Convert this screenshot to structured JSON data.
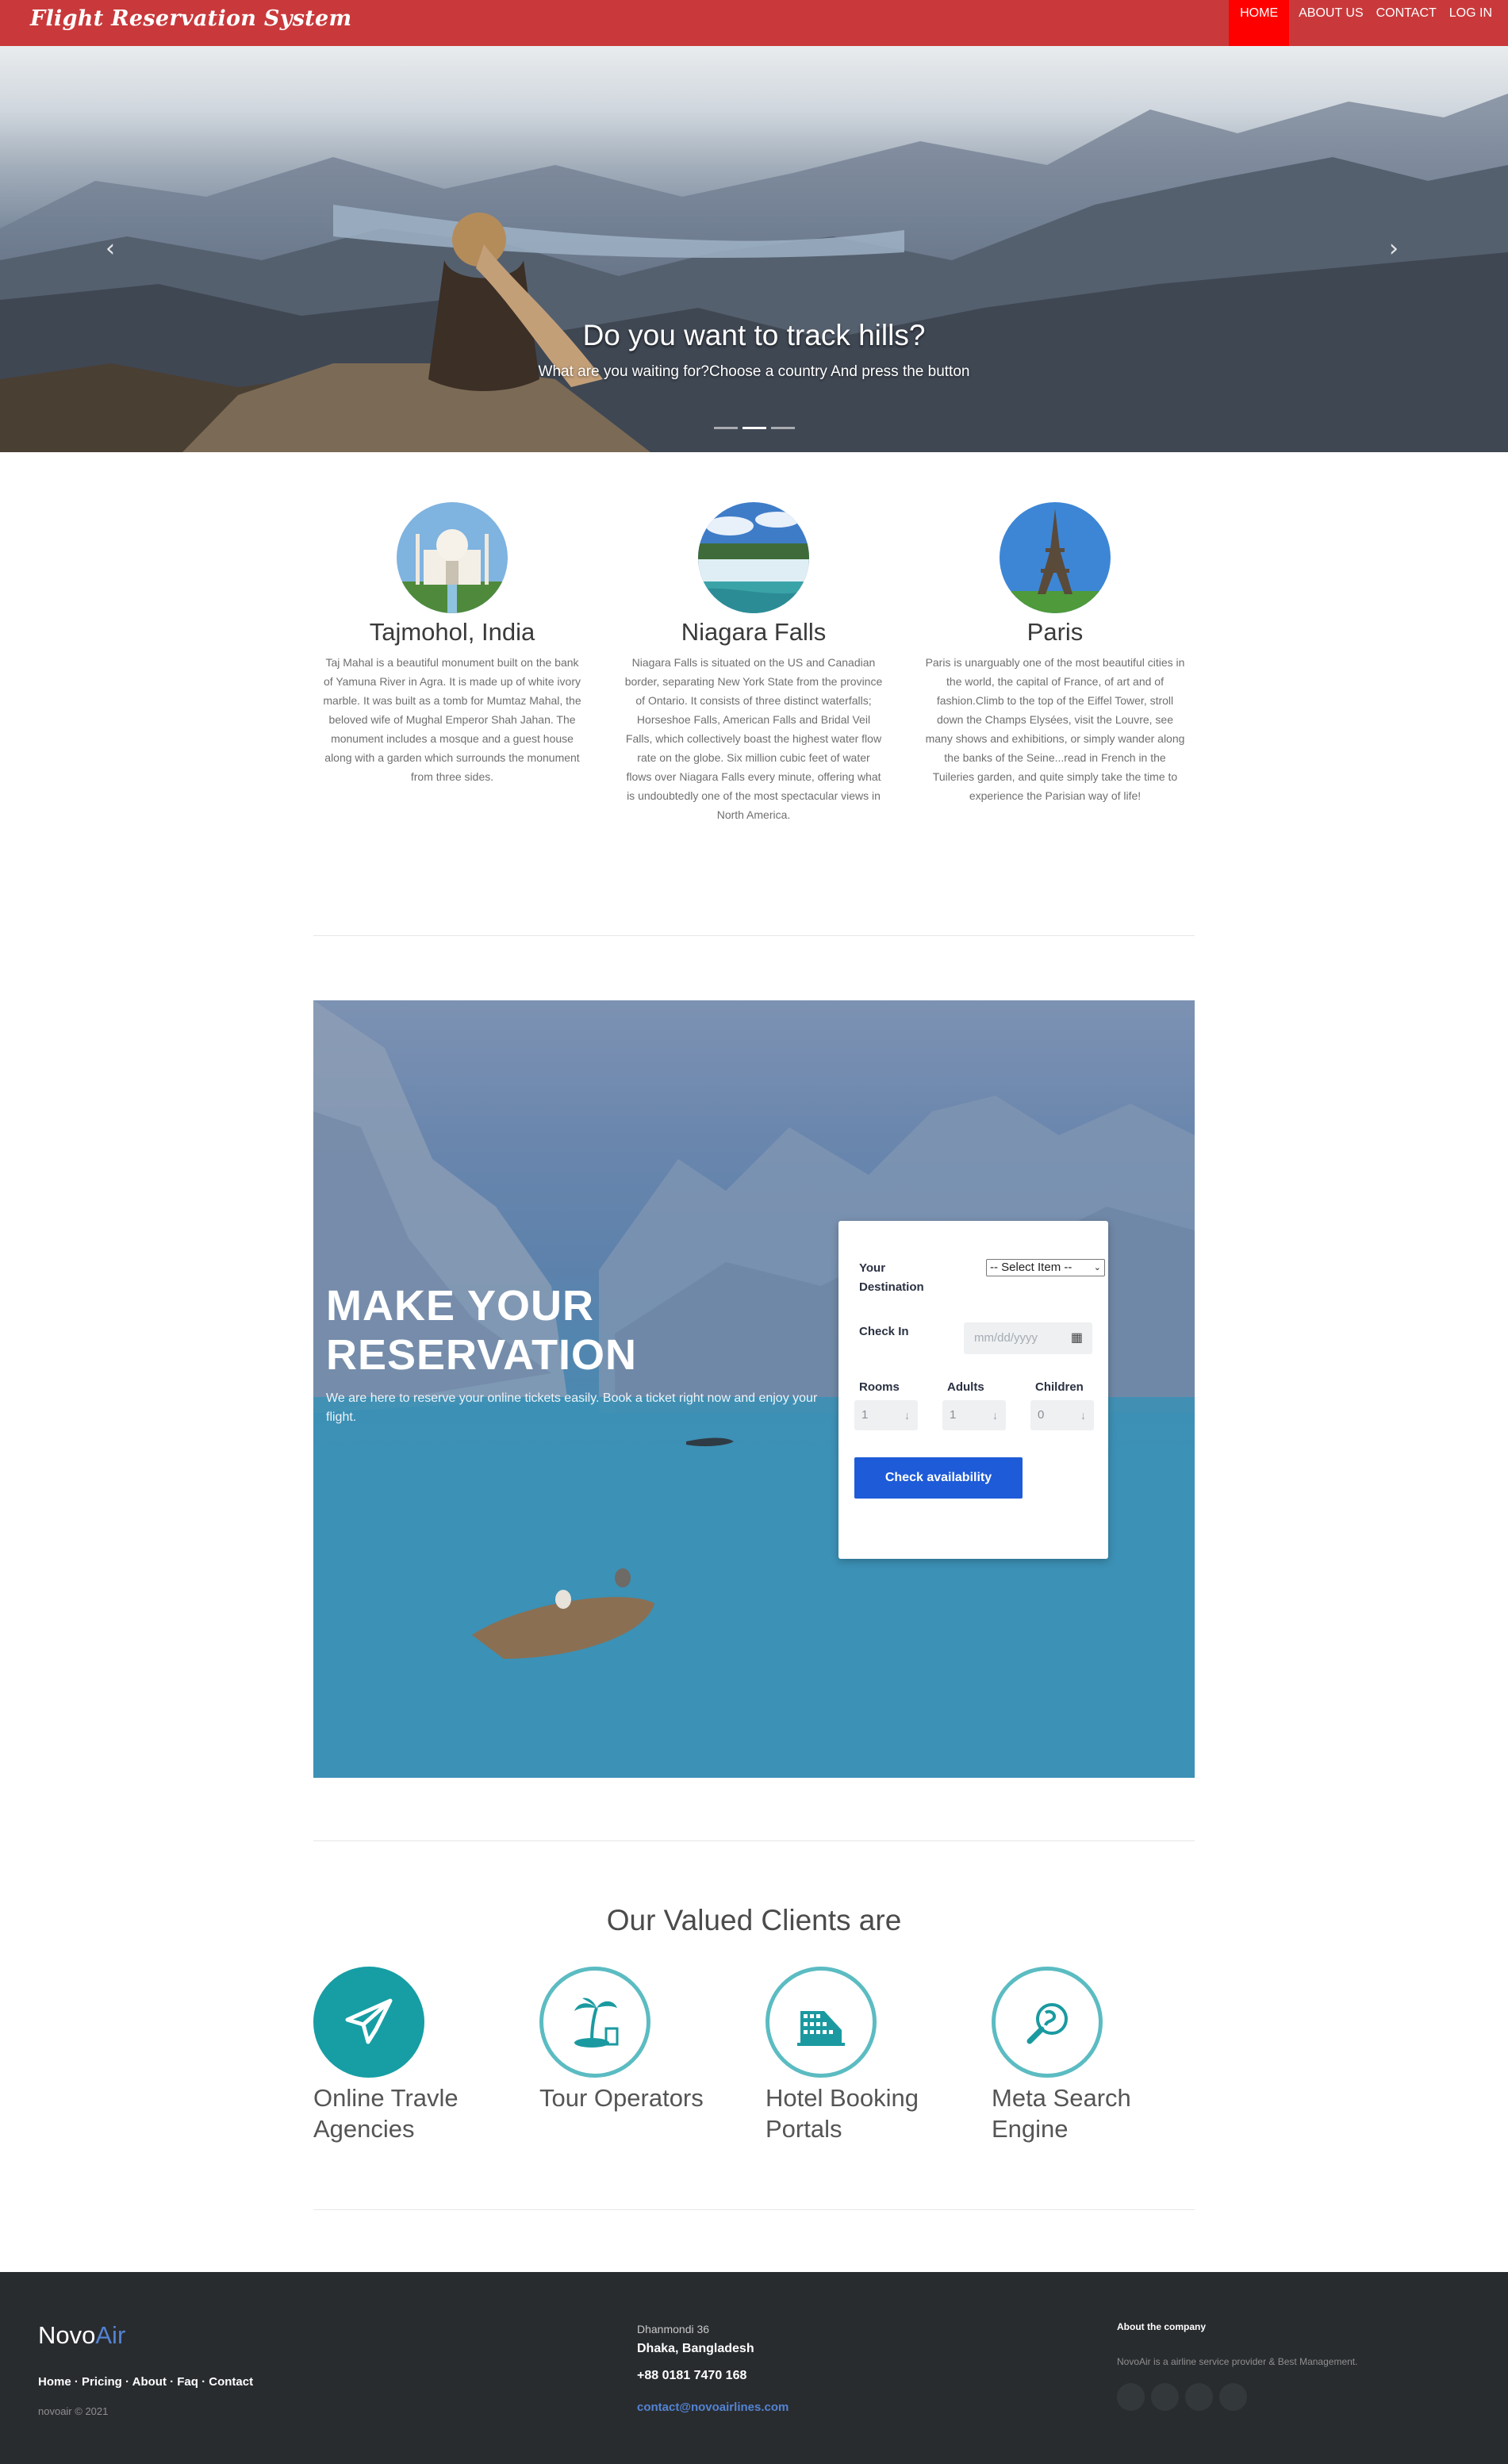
{
  "nav": {
    "brand": "Flight Reservation System",
    "links": [
      "HOME",
      "ABOUT US",
      "CONTACT",
      "LOG IN"
    ]
  },
  "hero": {
    "title": "Do you want to track hills?",
    "subtitle": "What are you waiting for?Choose a country And press the button",
    "slide_count": 3,
    "active_slide": 2
  },
  "destinations": [
    {
      "name": "Tajmohol, India",
      "text": "Taj Mahal is a beautiful monument built on the bank of Yamuna River in Agra. It is made up of white ivory marble. It was built as a tomb for Mumtaz Mahal, the beloved wife of Mughal Emperor Shah Jahan. The monument includes a mosque and a guest house along with a garden which surrounds the monument from three sides."
    },
    {
      "name": "Niagara Falls",
      "text": "Niagara Falls is situated on the US and Canadian border, separating New York State from the province of Ontario. It consists of three distinct waterfalls; Horseshoe Falls, American Falls and Bridal Veil Falls, which collectively boast the highest water flow rate on the globe. Six million cubic feet of water flows over Niagara Falls every minute, offering what is undoubtedly one of the most spectacular views in North America."
    },
    {
      "name": "Paris",
      "text": "Paris is unarguably one of the most beautiful cities in the world, the capital of France, of art and of fashion.Climb to the top of the Eiffel Tower, stroll down the Champs Elysées, visit the Louvre, see many shows and exhibitions, or simply wander along the banks of the Seine...read in French in the Tuileries garden, and quite simply take the time to experience the Parisian way of life!"
    }
  ],
  "reservation": {
    "title_line1": "MAKE YOUR",
    "title_line2": "RESERVATION",
    "text": "We are here to reserve your online tickets easily. Book a ticket right now and enjoy your flight.",
    "form": {
      "destination_label_1": "Your",
      "destination_label_2": "Destination",
      "destination_value": "-- Select Item --",
      "checkin_label": "Check In",
      "checkin_placeholder": "mm/dd/yyyy",
      "rooms_label": "Rooms",
      "adults_label": "Adults",
      "children_label": "Children",
      "rooms_value": "1",
      "adults_value": "1",
      "children_value": "0",
      "submit_label": "Check availability"
    }
  },
  "clients": {
    "title": "Our Valued Clients are",
    "items": [
      {
        "line1": "Online Travle",
        "line2": "Agencies",
        "icon": "paper-plane-icon"
      },
      {
        "line1": "Tour Operators",
        "line2": "",
        "icon": "palm-island-icon"
      },
      {
        "line1": "Hotel Booking",
        "line2": "Portals",
        "icon": "hotel-building-icon"
      },
      {
        "line1": "Meta Search",
        "line2": "Engine",
        "icon": "globe-search-icon"
      }
    ]
  },
  "footer": {
    "logo_part1": "Novo",
    "logo_part2": "Air",
    "links": "Home · Pricing · About · Faq · Contact",
    "copyright": "novoair © 2021",
    "address_line1": "Dhanmondi 36",
    "address_line2": "Dhaka, Bangladesh",
    "phone": "+88 0181 7470 168",
    "email": "contact@novoairlines.com",
    "about_heading": "About the company",
    "about_text": "NovoAir is a airline service provider & Best Management."
  },
  "colors": {
    "navbar": "#c9393b",
    "nav_active": "#ff0000",
    "button": "#1e5bd8",
    "teal": "#169ea4",
    "footer": "#292c2f",
    "link_blue": "#5383d3"
  }
}
